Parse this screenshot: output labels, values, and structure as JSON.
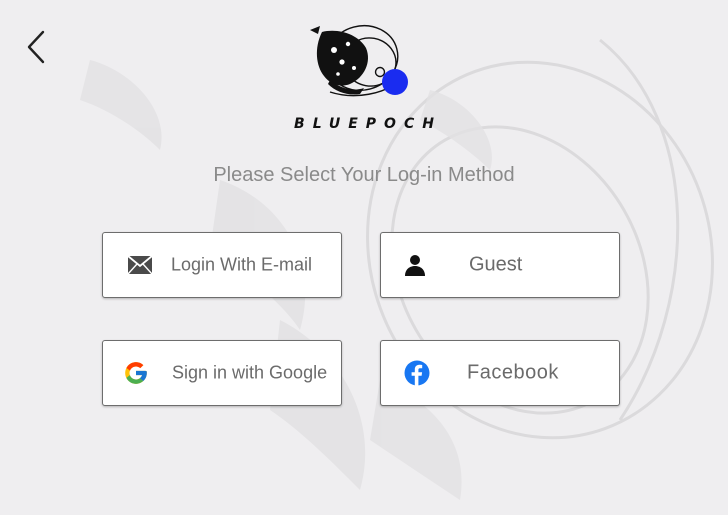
{
  "brand": {
    "name": "BLUEPOCH",
    "accent_color": "#1a2cf0"
  },
  "header": {
    "back_icon": "chevron-left-icon"
  },
  "prompt": {
    "title": "Please Select Your Log-in Method"
  },
  "login_options": {
    "email": {
      "label": "Login With E-mail",
      "icon": "envelope-icon"
    },
    "guest": {
      "label": "Guest",
      "icon": "person-icon"
    },
    "google": {
      "label": "Sign in with Google",
      "icon": "google-icon"
    },
    "facebook": {
      "label": "Facebook",
      "icon": "facebook-icon",
      "color": "#1877f2"
    }
  }
}
